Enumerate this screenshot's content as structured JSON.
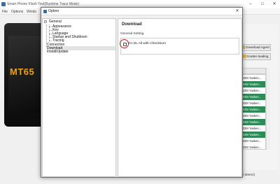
{
  "app": {
    "title": "Smart Phone Flash Tool(Runtime Trace Mode)",
    "menu": [
      "File",
      "Options",
      "Windo"
    ],
    "window_controls": [
      "–",
      "□",
      "✕"
    ],
    "phone_brand": "MT65",
    "buttons": [
      {
        "label": "Download Agent",
        "icon": "folder-icon"
      },
      {
        "label": "Scatter-loading",
        "icon": "folder-icon"
      }
    ],
    "list_rows": [
      {
        "text": "ROM Yaoken...",
        "highlight": false
      },
      {
        "text": "ROM Yaoken...",
        "highlight": true
      },
      {
        "text": "ROM Yaoken...",
        "highlight": false
      },
      {
        "text": "ROM Yaoken...",
        "highlight": true
      },
      {
        "text": "ROM Yaoken...",
        "highlight": false
      },
      {
        "text": "ROM Yaoken...",
        "highlight": true
      },
      {
        "text": "ROM Yaoken...",
        "highlight": false
      },
      {
        "text": "ROM Yaoken...",
        "highlight": true
      },
      {
        "text": "ROM Yaoken...",
        "highlight": false
      },
      {
        "text": "ROM Yaoken...",
        "highlight": true
      },
      {
        "text": "ROM Yaoken...",
        "highlight": false
      },
      {
        "text": "ROM Yaoken...",
        "highlight": false
      }
    ],
    "status_text": "o detect)"
  },
  "dialog": {
    "title": "Option",
    "close": "✕",
    "tree": {
      "general": "General",
      "children": [
        "Appearance",
        "Key",
        "Language",
        "Startup and Shutdown",
        "Tracing"
      ],
      "connection": "Connection",
      "download": "Download",
      "install": "Install/Update",
      "toggle": "−"
    },
    "content": {
      "title": "Download",
      "group_label": "General Setting",
      "checkbox_label": "DA DL All with Checksum",
      "checkbox_checked": false
    }
  },
  "colors": {
    "highlight_circle": "#d0181e",
    "list_green": "#2e8b57",
    "brand_orange": "#f0a010"
  }
}
